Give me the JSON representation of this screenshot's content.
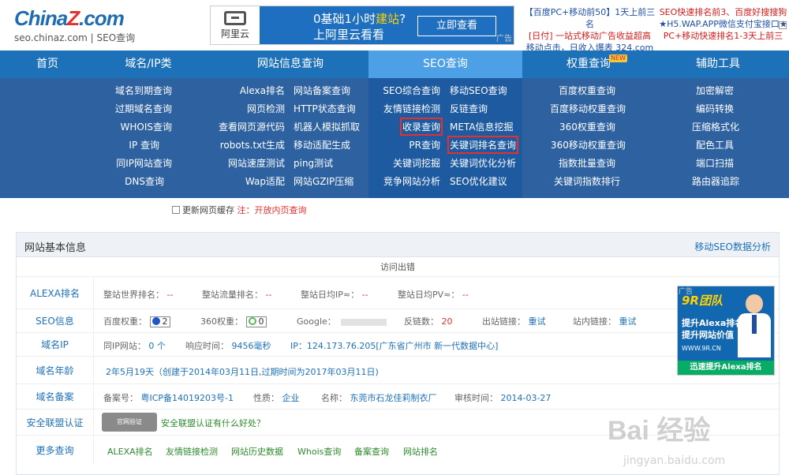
{
  "header": {
    "logo_main_a": "China",
    "logo_main_z": "Z",
    "logo_main_b": ".com",
    "logo_sub": "seo.chinaz.com | SEO查询",
    "banner": {
      "brand": "阿里云",
      "line1_a": "0基础1小时",
      "line1_hl": "建站",
      "line1_b": "?",
      "line2": "上阿里云看看",
      "button": "立即查看",
      "tag": "广告"
    },
    "top_ads": {
      "c1": [
        "【百度PC+移动前50】1天上前三名",
        "[日付] 一站式移动广告收益超高",
        "移动点击，日收入爆表 324.com"
      ],
      "c2": [
        "SEO快速排名前3、百度好搜搜狗",
        "★H5.WAP.APP微信支付宝接口★",
        "PC+移动快速排名1-3天上前三"
      ]
    }
  },
  "nav": {
    "items": [
      {
        "label": "首页"
      },
      {
        "label": "域名/IP类"
      },
      {
        "label": "网站信息查询"
      },
      {
        "label": "SEO查询"
      },
      {
        "label": "权重查询"
      },
      {
        "label": "辅助工具"
      }
    ],
    "new_badge": "NEW"
  },
  "dropdown": {
    "col1": [
      "域名到期查询",
      "过期域名查询",
      "WHOIS查询",
      "IP 查询",
      "同IP网站查询",
      "DNS查询"
    ],
    "col2a": [
      "Alexa排名",
      "网页检测",
      "查看网页源代码",
      "robots.txt生成",
      "网站速度测试",
      "Wap适配"
    ],
    "col2b": [
      "网站备案查询",
      "HTTP状态查询",
      "机器人模拟抓取",
      "移动适配生成",
      "ping测试",
      "网站GZIP压缩"
    ],
    "col3a": [
      "SEO综合查询",
      "友情链接检测",
      "收录查询",
      "PR查询",
      "关键词挖掘",
      "竞争网站分析"
    ],
    "col3b": [
      "移动SEO查询",
      "反链查询",
      "META信息挖掘",
      "关键词排名查询",
      "关键词优化分析",
      "SEO优化建议"
    ],
    "col4": [
      "百度权重查询",
      "百度移动权重查询",
      "360权重查询",
      "360移动权重查询",
      "指数批量查询",
      "关键词指数排行"
    ],
    "col5": [
      "加密解密",
      "编码转换",
      "压缩格式化",
      "配色工具",
      "端口扫描",
      "路由器追踪"
    ]
  },
  "refresh": {
    "label": "更新网页缓存",
    "note": "注：开放内页查询"
  },
  "panel": {
    "title": "网站基本信息",
    "link": "移动SEO数据分析",
    "access": "访问出错",
    "alexa": {
      "label": "ALEXA排名",
      "world": "整站世界排名：",
      "flow": "整站流量排名：",
      "ip": "整站日均IP≈：",
      "pv": "整站日均PV≈：",
      "dash": "--"
    },
    "seo": {
      "label": "SEO信息",
      "baidu": "百度权重：",
      "baidu_val": "2",
      "w360": "360权重：",
      "w360_val": "0",
      "google": "Google：",
      "backlinks": "反链数：",
      "backlinks_val": "20",
      "out": "出站链接：",
      "out_val": "重试",
      "in": "站内链接：",
      "in_val": "重试"
    },
    "ip": {
      "label": "域名IP",
      "same": "同IP网站：",
      "same_val": "0 个",
      "resp": "响应时间：",
      "resp_val": "9456毫秒",
      "ip": "IP：124.173.76.205[广东省广州市 新一代数据中心]"
    },
    "age": {
      "label": "域名年龄",
      "value": "2年5月19天（创建于2014年03月11日,过期时间为2017年03月11日)"
    },
    "icp": {
      "label": "域名备案",
      "no": "备案号：",
      "no_val": "粤ICP备14019203号-1",
      "nature": "性质：",
      "nature_val": "企业",
      "name": "名称：",
      "name_val": "东莞市石龙佳莉制衣厂",
      "time": "审核时间：",
      "time_val": "2014-03-27"
    },
    "security": {
      "label": "安全联盟认证",
      "seal": "官网验证",
      "link": "安全联盟认证有什么好处？"
    },
    "more": {
      "label": "更多查询",
      "links": [
        "ALEXA排名",
        "友情链接检测",
        "网站历史数据",
        "Whois查询",
        "备案查询",
        "网站排名"
      ]
    }
  },
  "side_ad": {
    "tag": "广告",
    "team": "9R团队",
    "l1": "提升Alexa排名",
    "l2": "提升网站价值",
    "url": "WWW.9R.CN",
    "cta": "迅速提升Alexa排名"
  },
  "watermark": {
    "big": "Bai 经验",
    "small": "jingyan.baidu.com"
  }
}
